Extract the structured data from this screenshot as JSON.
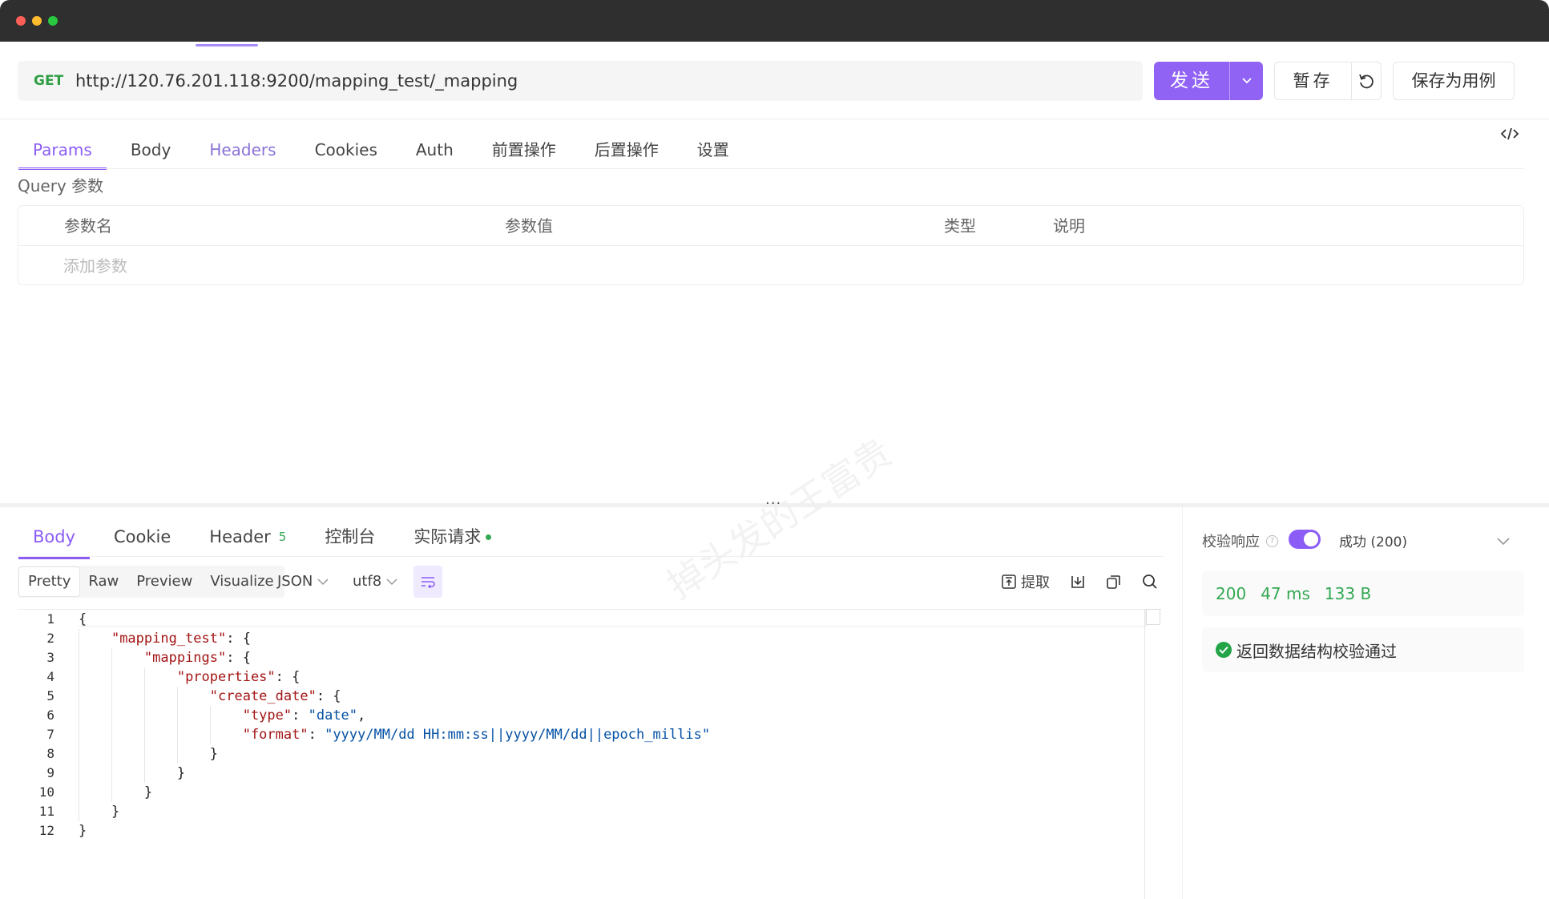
{
  "request": {
    "method": "GET",
    "url": "http://120.76.201.118:9200/mapping_test/_mapping",
    "send_label": "发送",
    "save_tmp_label": "暂存",
    "save_case_label": "保存为用例"
  },
  "req_tabs": [
    "Params",
    "Body",
    "Headers",
    "Cookies",
    "Auth",
    "前置操作",
    "后置操作",
    "设置"
  ],
  "params": {
    "section_label": "Query 参数",
    "columns": [
      "参数名",
      "参数值",
      "类型",
      "说明"
    ],
    "add_placeholder": "添加参数"
  },
  "watermark": "掉头发的王富贵",
  "res_tabs": {
    "body": "Body",
    "cookie": "Cookie",
    "header": "Header",
    "header_count": "5",
    "console": "控制台",
    "actual": "实际请求"
  },
  "formats": [
    "Pretty",
    "Raw",
    "Preview",
    "Visualize"
  ],
  "format_select": "JSON",
  "encoding_select": "utf8",
  "extract_label": "提取",
  "code_lines": [
    {
      "n": "1",
      "indent": 0,
      "parts": [
        [
          "p",
          "{"
        ]
      ]
    },
    {
      "n": "2",
      "indent": 1,
      "parts": [
        [
          "k",
          "\"mapping_test\""
        ],
        [
          "p",
          ": {"
        ]
      ]
    },
    {
      "n": "3",
      "indent": 2,
      "parts": [
        [
          "k",
          "\"mappings\""
        ],
        [
          "p",
          ": {"
        ]
      ]
    },
    {
      "n": "4",
      "indent": 3,
      "parts": [
        [
          "k",
          "\"properties\""
        ],
        [
          "p",
          ": {"
        ]
      ]
    },
    {
      "n": "5",
      "indent": 4,
      "parts": [
        [
          "k",
          "\"create_date\""
        ],
        [
          "p",
          ": {"
        ]
      ]
    },
    {
      "n": "6",
      "indent": 5,
      "parts": [
        [
          "k",
          "\"type\""
        ],
        [
          "p",
          ": "
        ],
        [
          "s",
          "\"date\""
        ],
        [
          "p",
          ","
        ]
      ]
    },
    {
      "n": "7",
      "indent": 5,
      "parts": [
        [
          "k",
          "\"format\""
        ],
        [
          "p",
          ": "
        ],
        [
          "s",
          "\"yyyy/MM/dd HH:mm:ss||yyyy/MM/dd||epoch_millis\""
        ]
      ]
    },
    {
      "n": "8",
      "indent": 4,
      "parts": [
        [
          "p",
          "}"
        ]
      ]
    },
    {
      "n": "9",
      "indent": 3,
      "parts": [
        [
          "p",
          "}"
        ]
      ]
    },
    {
      "n": "10",
      "indent": 2,
      "parts": [
        [
          "p",
          "}"
        ]
      ]
    },
    {
      "n": "11",
      "indent": 1,
      "parts": [
        [
          "p",
          "}"
        ]
      ]
    },
    {
      "n": "12",
      "indent": 0,
      "parts": [
        [
          "p",
          "}"
        ]
      ]
    }
  ],
  "validation": {
    "label": "校验响应",
    "enabled": true,
    "status_select": "成功 (200)",
    "status_code": "200",
    "time": "47 ms",
    "size": "133 B",
    "result": "返回数据结构校验通过"
  },
  "colors": {
    "accent": "#8b5cf6",
    "send_button": "#9163f5",
    "method_get": "#2e9e44",
    "success": "#33a852"
  }
}
